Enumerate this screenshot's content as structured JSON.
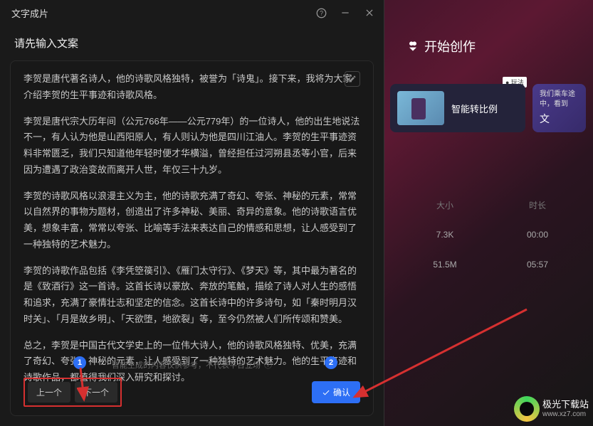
{
  "modal": {
    "title": "文字成片",
    "subtitle": "请先输入文案",
    "paragraphs": [
      "李贺是唐代著名诗人，他的诗歌风格独特，被誉为「诗鬼」。接下来，我将为大家介绍李贺的生平事迹和诗歌风格。",
      "李贺是唐代宗大历年间（公元766年——公元779年）的一位诗人，他的出生地说法不一，有人认为他是山西阳原人，有人则认为他是四川江油人。李贺的生平事迹资料非常匮乏，我们只知道他年轻时便才华横溢，曾经担任过河朔县丞等小官，后来因为遭遇了政治变故而离开人世，年仅三十九岁。",
      "李贺的诗歌风格以浪漫主义为主，他的诗歌充满了奇幻、夸张、神秘的元素，常常以自然界的事物为题材，创造出了许多神秘、美丽、奇异的意象。他的诗歌语言优美，想象丰富，常常以夸张、比喻等手法来表达自己的情感和思想，让人感受到了一种独特的艺术魅力。",
      "李贺的诗歌作品包括《李凭箜篌引》、《雁门太守行》、《梦天》等，其中最为著名的是《致酒行》这一首诗。这首长诗以豪放、奔放的笔触，描绘了诗人对人生的感悟和追求，充满了豪情壮志和坚定的信念。这首长诗中的许多诗句，如「秦时明月汉时关」、「月是故乡明」、「天欲堕，地欲裂」等，至今仍然被人们所传颂和赞美。",
      "总之，李贺是中国古代文学史上的一位伟大诗人，他的诗歌风格独特、优美，充满了奇幻、夸张、神秘的元素，让人感受到了一种独特的艺术魅力。他的生平事迹和诗歌作品，都值得我们深入研究和探讨。"
    ],
    "hint": "智能生成的内容仅供参考，不代表平台立场",
    "prev_label": "上一个",
    "next_label": "下一个",
    "confirm_label": "确认",
    "badge1": "1",
    "badge2": "2"
  },
  "right": {
    "start_label": "开始创作",
    "card1_label": "智能转比例",
    "tag": "● 玩法",
    "card2_line1": "我们乘车途",
    "card2_line2": "中，看到",
    "card2_title": "文",
    "table": {
      "col_size": "大小",
      "col_dur": "时长",
      "rows": [
        {
          "size": "7.3K",
          "dur": "00:00"
        },
        {
          "size": "51.5M",
          "dur": "05:57"
        }
      ]
    }
  },
  "logo": {
    "name": "极光下载站",
    "url": "www.xz7.com"
  }
}
